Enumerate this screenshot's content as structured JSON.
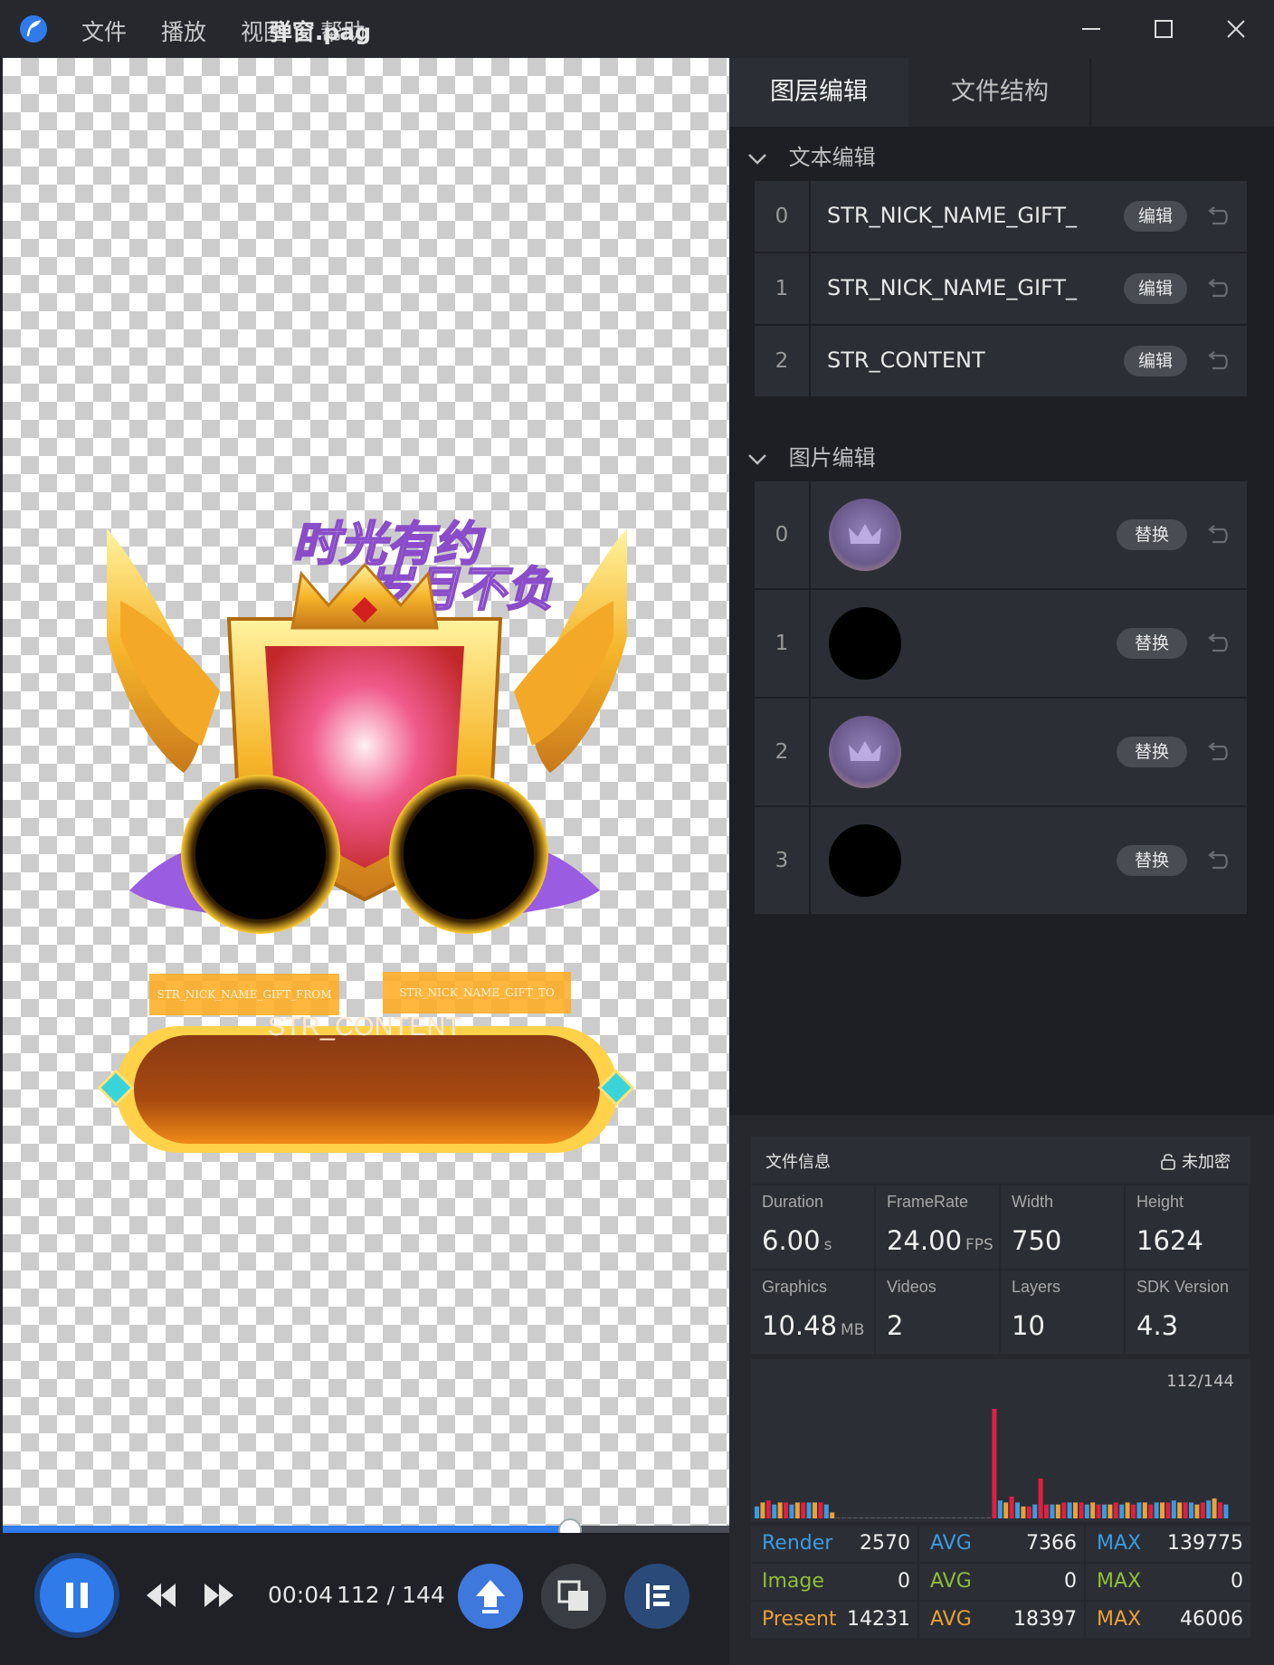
{
  "window": {
    "title": "弹窗.pag",
    "menu": [
      "文件",
      "播放",
      "视图",
      "帮助"
    ]
  },
  "preview": {
    "banner_from": "STR_NICK_NAME_GIFT_FROM",
    "banner_to": "STR_NICK_NAME_GIFT_TO",
    "content": "STR_CONTENT",
    "artwork_caption": "时光有约 岁月不负"
  },
  "playback": {
    "time": "00:04",
    "frame": "112",
    "total": "144",
    "progress": 0.778
  },
  "tabs": [
    "图层编辑",
    "文件结构"
  ],
  "text_edit": {
    "title": "文本编辑",
    "button": "编辑",
    "rows": [
      {
        "index": "0",
        "name": "STR_NICK_NAME_GIFT_"
      },
      {
        "index": "1",
        "name": "STR_NICK_NAME_GIFT_"
      },
      {
        "index": "2",
        "name": "STR_CONTENT"
      }
    ]
  },
  "image_edit": {
    "title": "图片编辑",
    "button": "替换",
    "rows": [
      {
        "index": "0",
        "thumb": "crown"
      },
      {
        "index": "1",
        "thumb": "black"
      },
      {
        "index": "2",
        "thumb": "crown"
      },
      {
        "index": "3",
        "thumb": "black"
      }
    ]
  },
  "file_info": {
    "title": "文件信息",
    "encryption": "未加密",
    "cells": [
      {
        "label": "Duration",
        "value": "6.00",
        "unit": "s"
      },
      {
        "label": "FrameRate",
        "value": "24.00",
        "unit": "FPS"
      },
      {
        "label": "Width",
        "value": "750",
        "unit": ""
      },
      {
        "label": "Height",
        "value": "1624",
        "unit": ""
      },
      {
        "label": "Graphics",
        "value": "10.48",
        "unit": "MB"
      },
      {
        "label": "Videos",
        "value": "2",
        "unit": ""
      },
      {
        "label": "Layers",
        "value": "10",
        "unit": ""
      },
      {
        "label": "SDK Version",
        "value": "4.3",
        "unit": ""
      }
    ]
  },
  "perf_graph": {
    "counter": "112/144",
    "bars": [
      12,
      16,
      18,
      14,
      16,
      16,
      14,
      16,
      16,
      16,
      16,
      16,
      14,
      6,
      1,
      1,
      1,
      1,
      1,
      1,
      1,
      1,
      1,
      1,
      1,
      1,
      1,
      1,
      1,
      1,
      1,
      1,
      1,
      1,
      1,
      1,
      1,
      1,
      1,
      1,
      1,
      110,
      18,
      16,
      22,
      16,
      12,
      12,
      14,
      40,
      14,
      14,
      14,
      16,
      16,
      16,
      16,
      14,
      16,
      14,
      14,
      14,
      16,
      14,
      16,
      14,
      16,
      16,
      14,
      16,
      16,
      16,
      18,
      16,
      16,
      16,
      14,
      16,
      18,
      20,
      16,
      14
    ]
  },
  "stats": {
    "render": {
      "label": "Render",
      "value": "2570",
      "avg": "7366",
      "max": "139775"
    },
    "image": {
      "label": "Image",
      "value": "0",
      "avg": "0",
      "max": "0"
    },
    "present": {
      "label": "Present",
      "value": "14231",
      "avg": "18397",
      "max": "46006"
    },
    "avg_label": "AVG",
    "max_label": "MAX"
  },
  "colors": {
    "accent": "#2f7bea",
    "render": "#3a9ce0",
    "image": "#8fbe3a",
    "present": "#e9a13a",
    "spike": "#e02040"
  }
}
